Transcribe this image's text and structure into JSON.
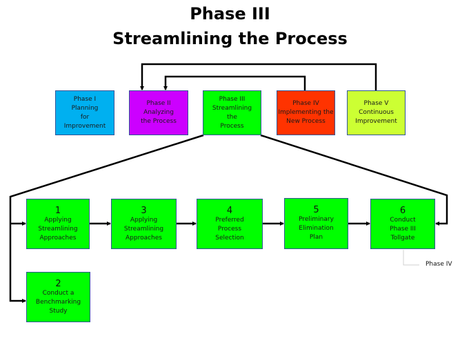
{
  "title": {
    "line1": "Phase III",
    "line2": "Streamlining the Process"
  },
  "phases": [
    {
      "id": "phase-1",
      "lines": [
        "Phase I",
        "Planning",
        "for",
        "Improvement"
      ],
      "color": "#00b0f0"
    },
    {
      "id": "phase-2",
      "lines": [
        "Phase II",
        "Analyzing",
        "the Process"
      ],
      "color": "#cc00ff"
    },
    {
      "id": "phase-3",
      "lines": [
        "Phase III",
        "Streamlining",
        "the",
        "Process"
      ],
      "color": "#00ff00"
    },
    {
      "id": "phase-4",
      "lines": [
        "Phase IV",
        "Implementing the",
        "New Process"
      ],
      "color": "#ff3300"
    },
    {
      "id": "phase-5",
      "lines": [
        "Phase V",
        "Continuous",
        "Improvement"
      ],
      "color": "#ccff33"
    }
  ],
  "steps": [
    {
      "number": "1",
      "lines": [
        "Applying",
        "Streamlining",
        "Approaches"
      ]
    },
    {
      "number": "3",
      "lines": [
        "Applying",
        "Streamlining",
        "Approaches"
      ]
    },
    {
      "number": "4",
      "lines": [
        "Preferred",
        "Process",
        "Selection"
      ]
    },
    {
      "number": "5",
      "lines": [
        "Preliminary",
        "Elimination",
        "Plan"
      ]
    },
    {
      "number": "6",
      "lines": [
        "Conduct",
        "Phase III",
        "Tollgate"
      ]
    },
    {
      "number": "2",
      "lines": [
        "Conduct a",
        "Benchmarking",
        "Study"
      ]
    }
  ],
  "step_color": "#00ff00",
  "next_phase_label": "Phase IV"
}
